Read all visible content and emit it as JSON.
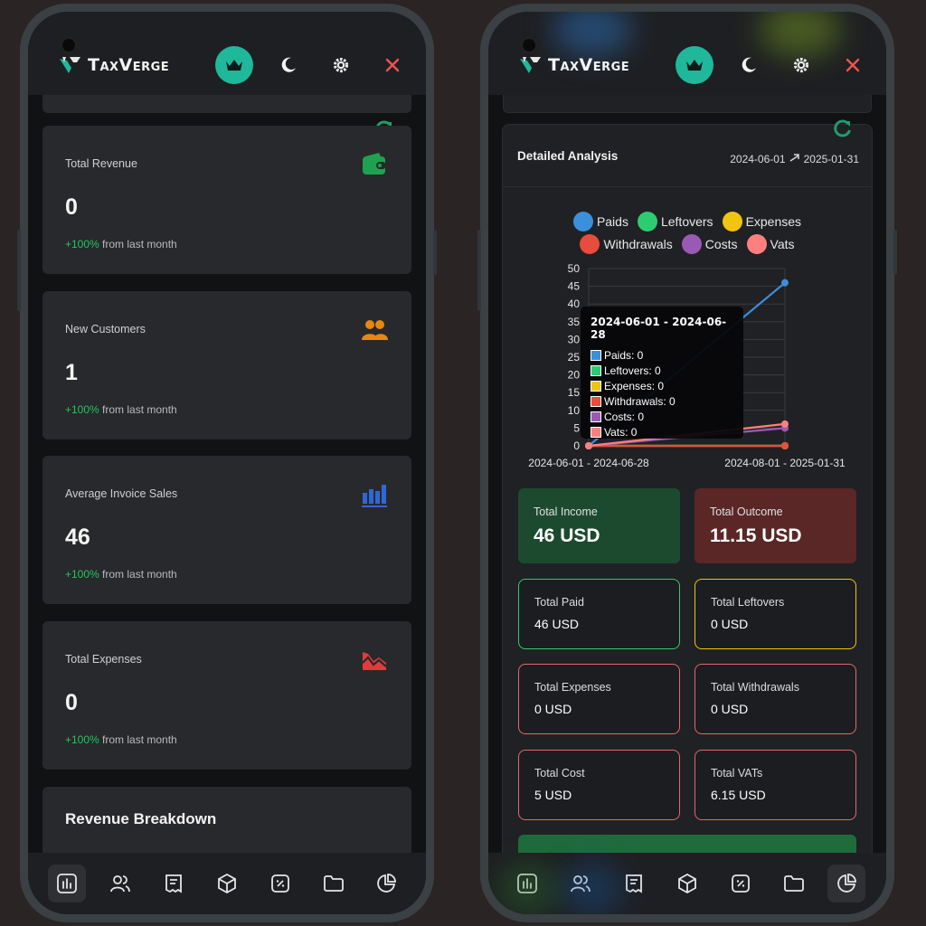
{
  "app": {
    "logo_text": "TaxVerge"
  },
  "left": {
    "cards": [
      {
        "label": "Total Revenue",
        "value": "0",
        "change": "+100%",
        "suffix": " from last month",
        "icon": "wallet-icon"
      },
      {
        "label": "New Customers",
        "value": "1",
        "change": "+100%",
        "suffix": " from last month",
        "icon": "users-icon"
      },
      {
        "label": "Average Invoice Sales",
        "value": "46",
        "change": "+100%",
        "suffix": " from last month",
        "icon": "bar-chart-icon"
      },
      {
        "label": "Total Expenses",
        "value": "0",
        "change": "+100%",
        "suffix": " from last month",
        "icon": "trend-down-icon"
      }
    ],
    "breakdown_title": "Revenue Breakdown"
  },
  "right": {
    "analysis_title": "Detailed Analysis",
    "date_from": "2024-06-01",
    "date_to": "2025-01-31",
    "tooltip": {
      "title": "2024-06-01 - 2024-06-28",
      "rows": [
        "Paids: 0",
        "Leftovers: 0",
        "Expenses: 0",
        "Withdrawals: 0",
        "Costs: 0",
        "Vats: 0"
      ]
    },
    "summary": [
      {
        "label": "Total Income",
        "value": "46 USD"
      },
      {
        "label": "Total Outcome",
        "value": "11.15 USD"
      }
    ],
    "totals": [
      {
        "label": "Total Paid",
        "value": "46 USD"
      },
      {
        "label": "Total Leftovers",
        "value": "0 USD"
      },
      {
        "label": "Total Expenses",
        "value": "0 USD"
      },
      {
        "label": "Total Withdrawals",
        "value": "0 USD"
      },
      {
        "label": "Total Cost",
        "value": "5 USD"
      },
      {
        "label": "Total VATs",
        "value": "6.15 USD"
      }
    ]
  },
  "nav": [
    "dashboard-icon",
    "customers-icon",
    "invoice-icon",
    "products-icon",
    "tax-icon",
    "folder-icon",
    "reports-icon"
  ],
  "colors": {
    "accent": "#1fb89a",
    "positive": "#22c55e",
    "paids": "#3b8fdb",
    "leftovers": "#2ecc71",
    "expenses": "#f1c40f",
    "withdrawals": "#e74c3c",
    "costs": "#9b59b6",
    "vats": "#ff7f7f",
    "income_bg": "#1c4a2e",
    "outcome_bg": "#5a2626"
  },
  "chart_data": {
    "type": "line",
    "title": "",
    "categories": [
      "2024-06-01 - 2024-06-28",
      "2024-08-01 - 2025-01-31"
    ],
    "series": [
      {
        "name": "Paids",
        "values": [
          0,
          46
        ]
      },
      {
        "name": "Leftovers",
        "values": [
          0,
          0
        ]
      },
      {
        "name": "Expenses",
        "values": [
          0,
          0
        ]
      },
      {
        "name": "Withdrawals",
        "values": [
          0,
          0
        ]
      },
      {
        "name": "Costs",
        "values": [
          0,
          5
        ]
      },
      {
        "name": "Vats",
        "values": [
          0,
          6.15
        ]
      }
    ],
    "ylim": [
      0,
      50
    ],
    "yticks": [
      0,
      5,
      10,
      15,
      20,
      25,
      30,
      35,
      40,
      45,
      50
    ],
    "grid": true,
    "legend": "top"
  }
}
